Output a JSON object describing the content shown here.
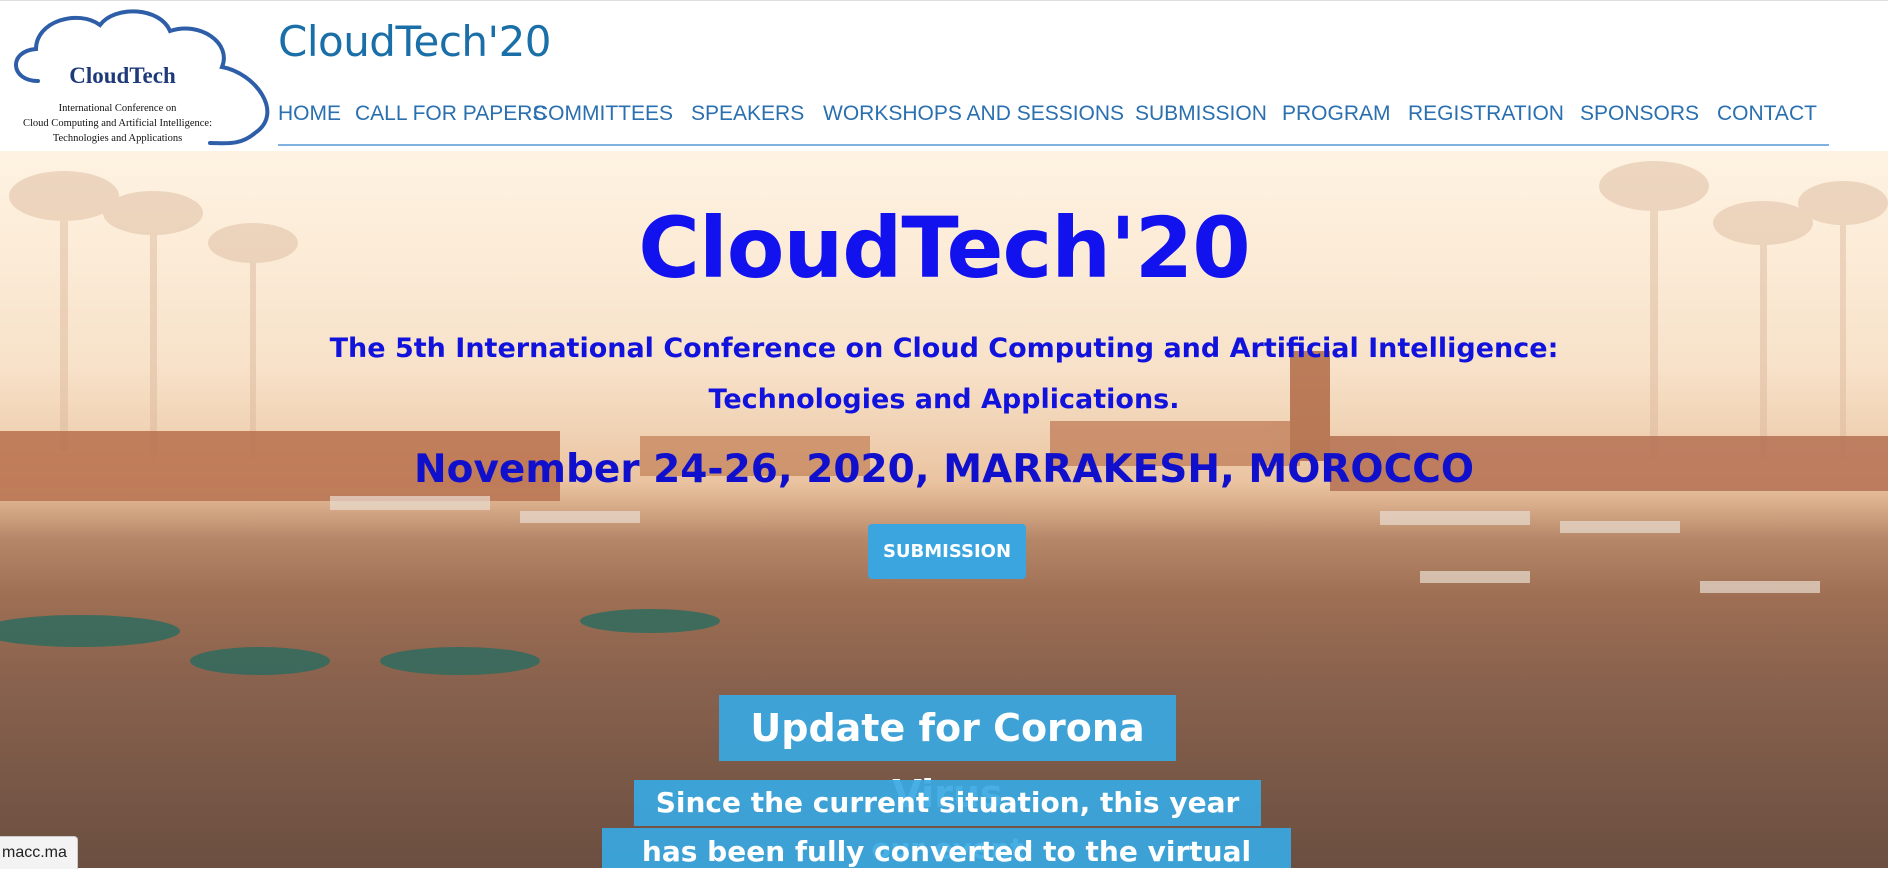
{
  "logo": {
    "brand": "CloudTech",
    "line1": "International Conference on",
    "line2": "Cloud Computing and Artificial Intelligence:",
    "line3": "Technologies and Applications"
  },
  "site_title": "CloudTech'20",
  "nav": [
    {
      "label": "HOME"
    },
    {
      "label": "CALL FOR PAPERS"
    },
    {
      "label": "COMMITTEES"
    },
    {
      "label": "SPEAKERS"
    },
    {
      "label": "WORKSHOPS AND SESSIONS"
    },
    {
      "label": "SUBMISSION"
    },
    {
      "label": "PROGRAM"
    },
    {
      "label": "REGISTRATION"
    },
    {
      "label": "SPONSORS"
    },
    {
      "label": "CONTACT"
    }
  ],
  "hero": {
    "title": "CloudTech'20",
    "subtitle_line1": "The 5th International Conference on Cloud Computing and Artificial Intelligence:",
    "subtitle_line2": "Technologies and Applications.",
    "date_location": "November 24-26, 2020, MARRAKESH, MOROCCO",
    "button_label": "SUBMISSION"
  },
  "notice": {
    "title": "Update for Corona Virus",
    "line1": "Since the current situation, this year our event",
    "line2": "has been fully converted to the virtual Conference."
  },
  "status_bar": {
    "url": "macc.ma"
  },
  "colors": {
    "nav_link": "#2a6faf",
    "hero_text": "#1212ee",
    "accent_button": "#3aa5df"
  }
}
